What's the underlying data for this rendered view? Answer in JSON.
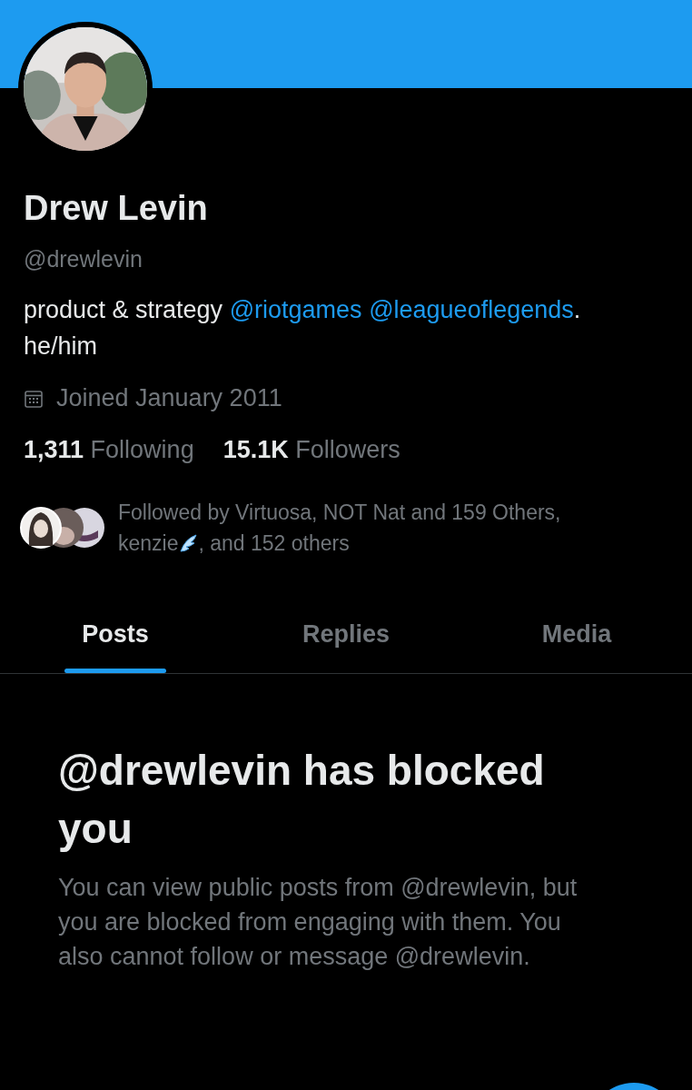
{
  "profile": {
    "name": "Drew Levin",
    "handle": "@drewlevin",
    "bio": [
      {
        "kind": "text",
        "text": "product & strategy "
      },
      {
        "kind": "mention",
        "text": "@riotgames"
      },
      {
        "kind": "mention",
        "text": "@leagueoflegends"
      },
      {
        "kind": "text",
        "text": ". he/him"
      }
    ],
    "joined": "Joined January 2011",
    "stats": [
      {
        "count": "1,311",
        "label": "Following"
      },
      {
        "count": "15.1K",
        "label": "Followers"
      }
    ],
    "followed_by": {
      "before": "Followed by Virtuosa, NOT Nat and 159 Others, kenzie",
      "after": ", and 152 others"
    }
  },
  "tabs": [
    {
      "label": "Posts",
      "selected": true
    },
    {
      "label": "Replies",
      "selected": false
    },
    {
      "label": "Media",
      "selected": false
    }
  ],
  "blocked": {
    "title": "@drewlevin has blocked you",
    "message": "You can view public posts from @drewlevin, but you are blocked from engaging with them. You also cannot follow or message @drewlevin."
  }
}
